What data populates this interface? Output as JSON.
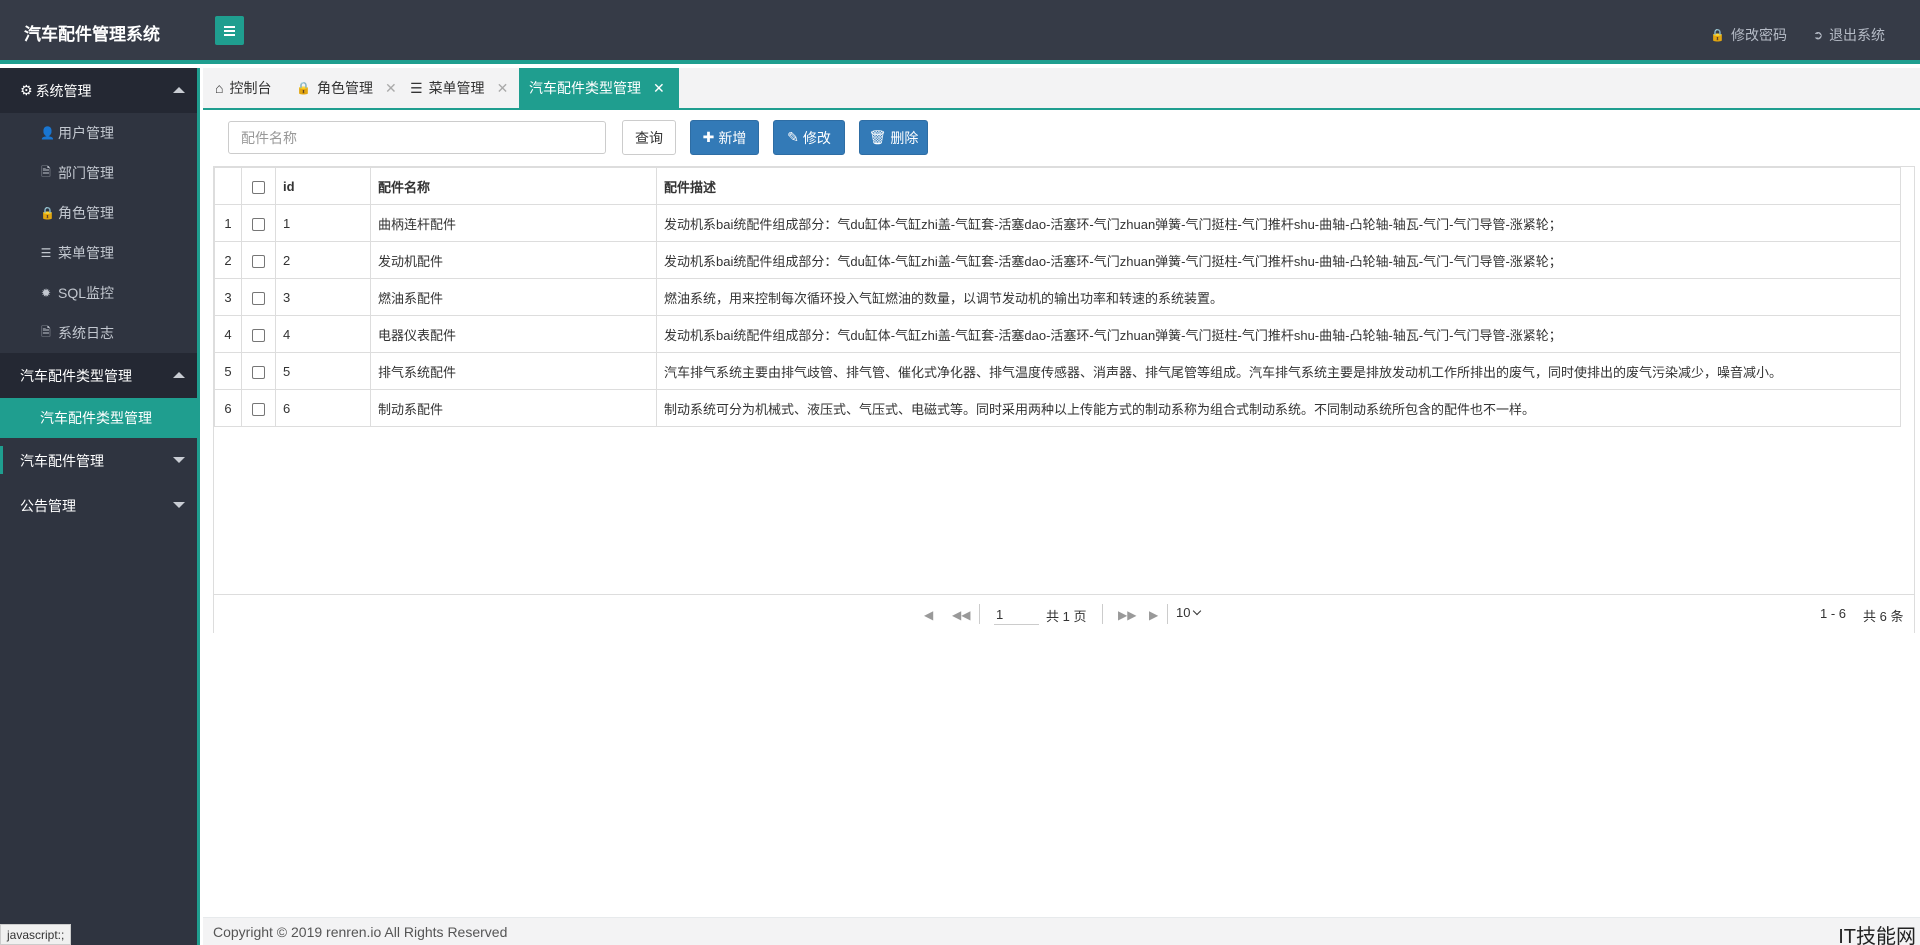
{
  "header": {
    "brand": "汽车配件管理系统",
    "change_password": "修改密码",
    "logout": "退出系统"
  },
  "sidebar": {
    "groups": [
      {
        "label": "系统管理",
        "expanded": true,
        "items": [
          {
            "label": "用户管理",
            "icon": "user-icon"
          },
          {
            "label": "部门管理",
            "icon": "file-icon"
          },
          {
            "label": "角色管理",
            "icon": "lock-icon"
          },
          {
            "label": "菜单管理",
            "icon": "list-icon"
          },
          {
            "label": "SQL监控",
            "icon": "bug-icon"
          },
          {
            "label": "系统日志",
            "icon": "file-text-icon"
          }
        ]
      },
      {
        "label": "汽车配件类型管理",
        "expanded": true,
        "items": [
          {
            "label": "汽车配件类型管理"
          }
        ]
      },
      {
        "label": "汽车配件管理",
        "expanded": false
      },
      {
        "label": "公告管理",
        "expanded": false
      }
    ]
  },
  "tabs": [
    {
      "label": "控制台",
      "icon": "home-icon",
      "closable": false
    },
    {
      "label": "角色管理",
      "icon": "lock-icon",
      "closable": true
    },
    {
      "label": "菜单管理",
      "icon": "list-icon",
      "closable": true
    },
    {
      "label": "汽车配件类型管理",
      "closable": true,
      "active": true
    }
  ],
  "toolbar": {
    "search_placeholder": "配件名称",
    "query": "查询",
    "add": "新增",
    "edit": "修改",
    "delete": "删除"
  },
  "table": {
    "columns": [
      "id",
      "配件名称",
      "配件描述"
    ],
    "rows": [
      {
        "rn": "1",
        "id": "1",
        "name": "曲柄连杆配件",
        "desc": "发动机系bai统配件组成部分：气du缸体-气缸zhi盖-气缸套-活塞dao-活塞环-气门zhuan弹簧-气门挺柱-气门推杆shu-曲轴-凸轮轴-轴瓦-气门-气门导管-涨紧轮；"
      },
      {
        "rn": "2",
        "id": "2",
        "name": "发动机配件",
        "desc": "发动机系bai统配件组成部分：气du缸体-气缸zhi盖-气缸套-活塞dao-活塞环-气门zhuan弹簧-气门挺柱-气门推杆shu-曲轴-凸轮轴-轴瓦-气门-气门导管-涨紧轮；"
      },
      {
        "rn": "3",
        "id": "3",
        "name": "燃油系配件",
        "desc": "燃油系统，用来控制每次循环投入气缸燃油的数量，以调节发动机的输出功率和转速的系统装置。"
      },
      {
        "rn": "4",
        "id": "4",
        "name": "电器仪表配件",
        "desc": "发动机系bai统配件组成部分：气du缸体-气缸zhi盖-气缸套-活塞dao-活塞环-气门zhuan弹簧-气门挺柱-气门推杆shu-曲轴-凸轮轴-轴瓦-气门-气门导管-涨紧轮；"
      },
      {
        "rn": "5",
        "id": "5",
        "name": "排气系统配件",
        "desc": "汽车排气系统主要由排气歧管、排气管、催化式净化器、排气温度传感器、消声器、排气尾管等组成。汽车排气系统主要是排放发动机工作所排出的废气，同时使排出的废气污染减少，噪音减小。"
      },
      {
        "rn": "6",
        "id": "6",
        "name": "制动系配件",
        "desc": "制动系统可分为机械式、液压式、气压式、电磁式等。同时采用两种以上传能方式的制动系称为组合式制动系统。不同制动系统所包含的配件也不一样。"
      }
    ]
  },
  "pager": {
    "page": "1",
    "total_pages": "共 1 页",
    "page_size": "10",
    "range": "1 - 6",
    "total": "共 6 条"
  },
  "footer": {
    "copyright": "Copyright © 2019  renren.io  All Rights Reserved",
    "watermark": "IT技能网"
  },
  "status_bar": "javascript:;"
}
